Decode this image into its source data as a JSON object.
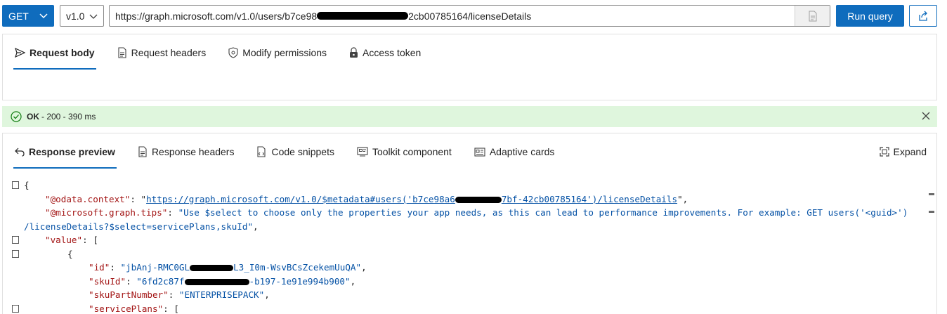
{
  "query_bar": {
    "method": "GET",
    "version": "v1.0",
    "url_start": "https://graph.microsoft.com/v1.0/users/b7ce98",
    "url_end": "2cb00785164/licenseDetails",
    "run_label": "Run query"
  },
  "request_tabs": [
    {
      "label": "Request body",
      "icon": "send-icon"
    },
    {
      "label": "Request headers",
      "icon": "document-icon"
    },
    {
      "label": "Modify permissions",
      "icon": "shield-icon"
    },
    {
      "label": "Access token",
      "icon": "lock-icon"
    }
  ],
  "status": {
    "ok": "OK",
    "detail": "- 200 - 390 ms"
  },
  "response_tabs": [
    {
      "label": "Response preview",
      "icon": "undo-arrow-icon"
    },
    {
      "label": "Response headers",
      "icon": "document-icon"
    },
    {
      "label": "Code snippets",
      "icon": "code-document-icon"
    },
    {
      "label": "Toolkit component",
      "icon": "component-icon"
    },
    {
      "label": "Adaptive cards",
      "icon": "card-icon"
    }
  ],
  "expand_label": "Expand",
  "code": {
    "brace_open": "{",
    "odata_key": "\"@odata.context\"",
    "odata_val_start": "https://graph.microsoft.com/v1.0/$metadata#users('b7ce98a6",
    "odata_val_end": "7bf-42cb00785164')/licenseDetails",
    "tips_key": "\"@microsoft.graph.tips\"",
    "tips_val_1": "\"Use $select to choose only the properties your app needs, as this can lead to performance improvements. For example: GET users('<guid>')",
    "tips_val_2": "/licenseDetails?$select=servicePlans,skuId\"",
    "value_key": "\"value\"",
    "id_key": "\"id\"",
    "id_val_start": "\"jbAnj-RMC0GL",
    "id_val_end": "L3_I0m-WsvBCsZcekemUuQA\"",
    "skuid_key": "\"skuId\"",
    "skuid_val_start": "\"6fd2c87f",
    "skuid_val_end": "-b197-1e91e994b900\"",
    "skupart_key": "\"skuPartNumber\"",
    "skupart_val": "\"ENTERPRISEPACK\"",
    "plans_key": "\"servicePlans\""
  }
}
